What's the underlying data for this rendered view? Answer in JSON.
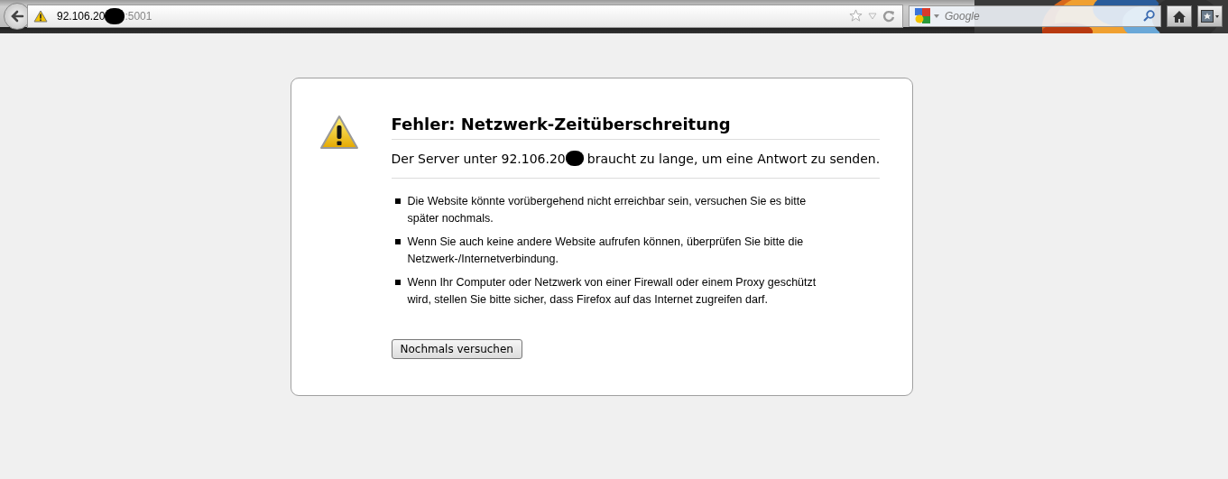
{
  "toolbar": {
    "url_host": "92.106.20",
    "url_port": ":5001",
    "search": {
      "placeholder": "Google"
    }
  },
  "error": {
    "title": "Fehler: Netzwerk-Zeitüberschreitung",
    "description_before": "Der Server unter 92.106.20",
    "description_after": "braucht zu lange, um eine Antwort zu senden.",
    "bullets": [
      "Die Website könnte vorübergehend nicht erreichbar sein, versuchen Sie es bitte später nochmals.",
      "Wenn Sie auch keine andere Website aufrufen können, überprüfen Sie bitte die Netzwerk-/Internetverbindung.",
      "Wenn Ihr Computer oder Netzwerk von einer Firewall oder einem Proxy geschützt wird, stellen Sie bitte sicher, dass Firefox auf das Internet zugreifen darf."
    ],
    "button": "Nochmals versuchen"
  }
}
